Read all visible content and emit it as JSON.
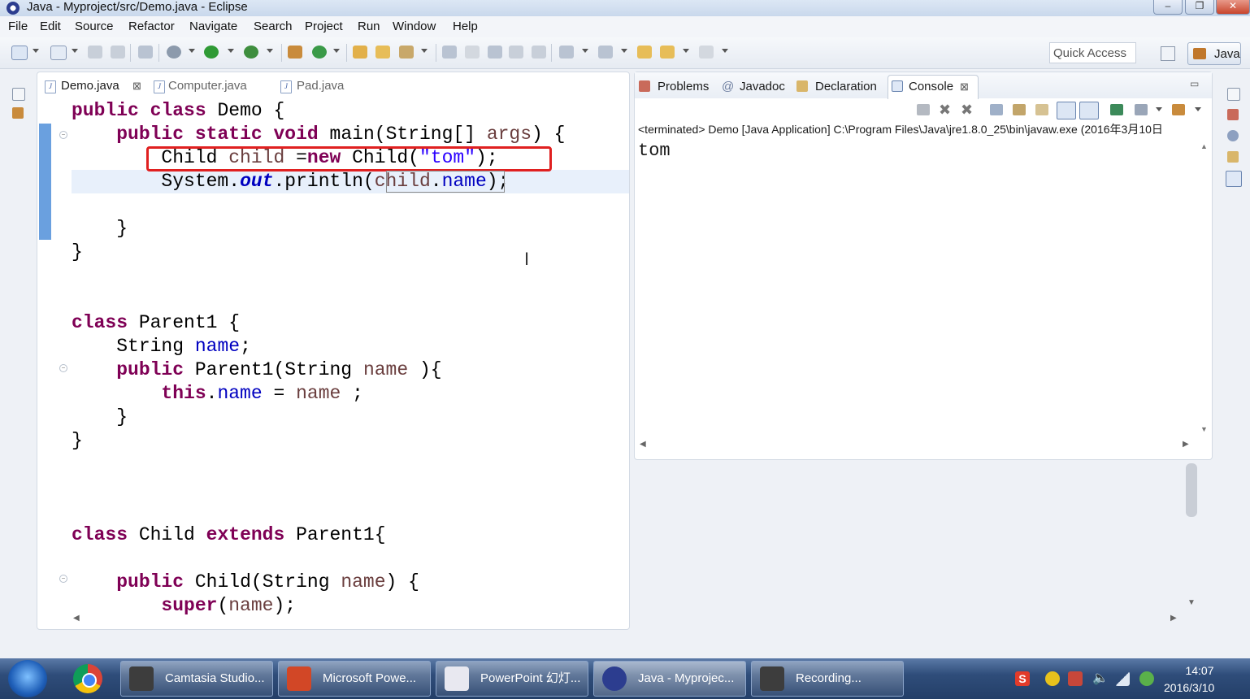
{
  "window": {
    "title": "Java - Myproject/src/Demo.java - Eclipse",
    "minimize": "–",
    "maximize": "❐",
    "close": "✕"
  },
  "menubar": [
    "File",
    "Edit",
    "Source",
    "Refactor",
    "Navigate",
    "Search",
    "Project",
    "Run",
    "Window",
    "Help"
  ],
  "toolbar": {
    "quick_access_placeholder": "Quick Access",
    "perspective_label": "Java"
  },
  "editor": {
    "tabs": [
      {
        "label": "Demo.java",
        "active": true
      },
      {
        "label": "Computer.java",
        "active": false
      },
      {
        "label": "Pad.java",
        "active": false
      }
    ],
    "code": [
      "public class Demo {",
      "    public static void main(String[] args) {",
      "        Child child =new Child(\"tom\");",
      "        System.out.println(child.name);",
      "",
      "    }",
      "}",
      "",
      "",
      "class Parent1 {",
      "    String name;",
      "    public Parent1(String name ){",
      "        this.name = name ;",
      "    }",
      "}",
      "",
      "",
      "",
      "class Child extends Parent1{",
      "",
      "    public Child(String name) {",
      "        super(name);"
    ]
  },
  "console_view": {
    "tabs": [
      {
        "label": "Problems",
        "icon": "problems-icon"
      },
      {
        "label": "Javadoc",
        "icon": "at-icon"
      },
      {
        "label": "Declaration",
        "icon": "declaration-icon"
      },
      {
        "label": "Console",
        "icon": "console-icon",
        "active": true
      }
    ],
    "description": "<terminated> Demo [Java Application] C:\\Program Files\\Java\\jre1.8.0_25\\bin\\javaw.exe (2016年3月10日",
    "output": "tom"
  },
  "taskbar": {
    "items": [
      {
        "label": "Camtasia Studio...",
        "color": "#3d3d3d"
      },
      {
        "label": "Microsoft Powe...",
        "color": "#d24726"
      },
      {
        "label": "PowerPoint 幻灯...",
        "color": "#e8e8f0"
      },
      {
        "label": "Java - Myprojec...",
        "color": "#2c3d8f"
      },
      {
        "label": "Recording...",
        "color": "#3d3d3d"
      }
    ],
    "time": "14:07",
    "date": "2016/3/10"
  },
  "colors": {
    "keyword": "#7f0055",
    "field": "#0000c0",
    "string": "#2a00ff",
    "highlight_box": "#e02020"
  }
}
